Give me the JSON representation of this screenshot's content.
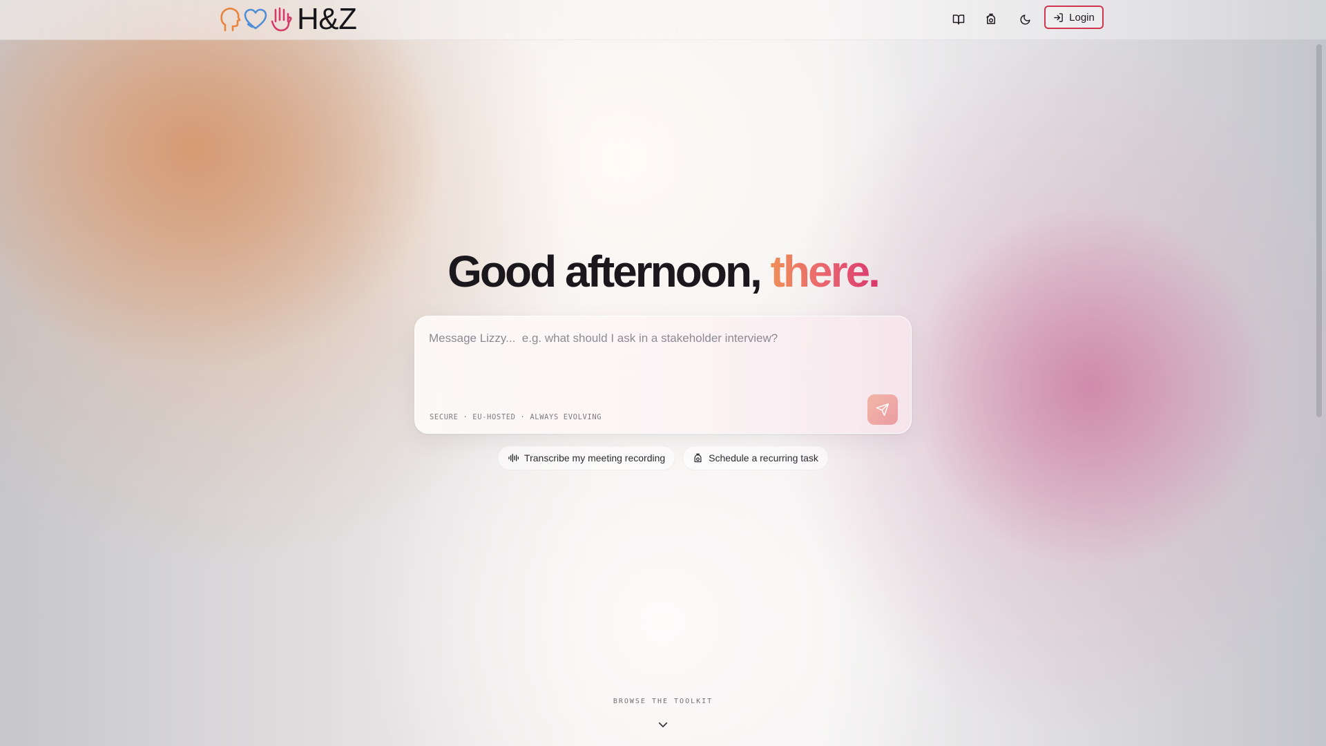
{
  "header": {
    "logo_text": "H&Z",
    "nav_icons": [
      "book-open-icon",
      "timer-icon",
      "moon-icon"
    ],
    "login_label": "Login"
  },
  "hero": {
    "greeting_main": "Good afternoon, ",
    "greeting_accent": "there."
  },
  "composer": {
    "placeholder": "Message Lizzy...  e.g. what should I ask in a stakeholder interview?",
    "footnote": "SECURE · EU-HOSTED · ALWAYS EVOLVING"
  },
  "chips": [
    {
      "label": "Transcribe my meeting recording",
      "icon": "audio-waveform-icon"
    },
    {
      "label": "Schedule a recurring task",
      "icon": "timer-icon"
    }
  ],
  "browse": {
    "label": "BROWSE THE TOOLKIT"
  },
  "colors": {
    "accent_start": "#ef8f58",
    "accent_end": "#d8376c",
    "login_border": "#d0344f",
    "logo_head": "#e8843e",
    "logo_heart": "#4f8ed6",
    "logo_hand": "#d43a6a"
  }
}
